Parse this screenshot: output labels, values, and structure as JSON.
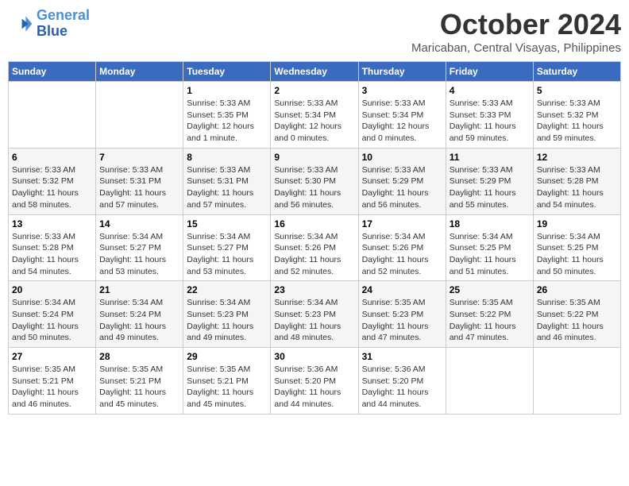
{
  "header": {
    "logo_line1": "General",
    "logo_line2": "Blue",
    "month": "October 2024",
    "location": "Maricaban, Central Visayas, Philippines"
  },
  "weekdays": [
    "Sunday",
    "Monday",
    "Tuesday",
    "Wednesday",
    "Thursday",
    "Friday",
    "Saturday"
  ],
  "weeks": [
    [
      {
        "day": "",
        "info": ""
      },
      {
        "day": "",
        "info": ""
      },
      {
        "day": "1",
        "info": "Sunrise: 5:33 AM\nSunset: 5:35 PM\nDaylight: 12 hours\nand 1 minute."
      },
      {
        "day": "2",
        "info": "Sunrise: 5:33 AM\nSunset: 5:34 PM\nDaylight: 12 hours\nand 0 minutes."
      },
      {
        "day": "3",
        "info": "Sunrise: 5:33 AM\nSunset: 5:34 PM\nDaylight: 12 hours\nand 0 minutes."
      },
      {
        "day": "4",
        "info": "Sunrise: 5:33 AM\nSunset: 5:33 PM\nDaylight: 11 hours\nand 59 minutes."
      },
      {
        "day": "5",
        "info": "Sunrise: 5:33 AM\nSunset: 5:32 PM\nDaylight: 11 hours\nand 59 minutes."
      }
    ],
    [
      {
        "day": "6",
        "info": "Sunrise: 5:33 AM\nSunset: 5:32 PM\nDaylight: 11 hours\nand 58 minutes."
      },
      {
        "day": "7",
        "info": "Sunrise: 5:33 AM\nSunset: 5:31 PM\nDaylight: 11 hours\nand 57 minutes."
      },
      {
        "day": "8",
        "info": "Sunrise: 5:33 AM\nSunset: 5:31 PM\nDaylight: 11 hours\nand 57 minutes."
      },
      {
        "day": "9",
        "info": "Sunrise: 5:33 AM\nSunset: 5:30 PM\nDaylight: 11 hours\nand 56 minutes."
      },
      {
        "day": "10",
        "info": "Sunrise: 5:33 AM\nSunset: 5:29 PM\nDaylight: 11 hours\nand 56 minutes."
      },
      {
        "day": "11",
        "info": "Sunrise: 5:33 AM\nSunset: 5:29 PM\nDaylight: 11 hours\nand 55 minutes."
      },
      {
        "day": "12",
        "info": "Sunrise: 5:33 AM\nSunset: 5:28 PM\nDaylight: 11 hours\nand 54 minutes."
      }
    ],
    [
      {
        "day": "13",
        "info": "Sunrise: 5:33 AM\nSunset: 5:28 PM\nDaylight: 11 hours\nand 54 minutes."
      },
      {
        "day": "14",
        "info": "Sunrise: 5:34 AM\nSunset: 5:27 PM\nDaylight: 11 hours\nand 53 minutes."
      },
      {
        "day": "15",
        "info": "Sunrise: 5:34 AM\nSunset: 5:27 PM\nDaylight: 11 hours\nand 53 minutes."
      },
      {
        "day": "16",
        "info": "Sunrise: 5:34 AM\nSunset: 5:26 PM\nDaylight: 11 hours\nand 52 minutes."
      },
      {
        "day": "17",
        "info": "Sunrise: 5:34 AM\nSunset: 5:26 PM\nDaylight: 11 hours\nand 52 minutes."
      },
      {
        "day": "18",
        "info": "Sunrise: 5:34 AM\nSunset: 5:25 PM\nDaylight: 11 hours\nand 51 minutes."
      },
      {
        "day": "19",
        "info": "Sunrise: 5:34 AM\nSunset: 5:25 PM\nDaylight: 11 hours\nand 50 minutes."
      }
    ],
    [
      {
        "day": "20",
        "info": "Sunrise: 5:34 AM\nSunset: 5:24 PM\nDaylight: 11 hours\nand 50 minutes."
      },
      {
        "day": "21",
        "info": "Sunrise: 5:34 AM\nSunset: 5:24 PM\nDaylight: 11 hours\nand 49 minutes."
      },
      {
        "day": "22",
        "info": "Sunrise: 5:34 AM\nSunset: 5:23 PM\nDaylight: 11 hours\nand 49 minutes."
      },
      {
        "day": "23",
        "info": "Sunrise: 5:34 AM\nSunset: 5:23 PM\nDaylight: 11 hours\nand 48 minutes."
      },
      {
        "day": "24",
        "info": "Sunrise: 5:35 AM\nSunset: 5:23 PM\nDaylight: 11 hours\nand 47 minutes."
      },
      {
        "day": "25",
        "info": "Sunrise: 5:35 AM\nSunset: 5:22 PM\nDaylight: 11 hours\nand 47 minutes."
      },
      {
        "day": "26",
        "info": "Sunrise: 5:35 AM\nSunset: 5:22 PM\nDaylight: 11 hours\nand 46 minutes."
      }
    ],
    [
      {
        "day": "27",
        "info": "Sunrise: 5:35 AM\nSunset: 5:21 PM\nDaylight: 11 hours\nand 46 minutes."
      },
      {
        "day": "28",
        "info": "Sunrise: 5:35 AM\nSunset: 5:21 PM\nDaylight: 11 hours\nand 45 minutes."
      },
      {
        "day": "29",
        "info": "Sunrise: 5:35 AM\nSunset: 5:21 PM\nDaylight: 11 hours\nand 45 minutes."
      },
      {
        "day": "30",
        "info": "Sunrise: 5:36 AM\nSunset: 5:20 PM\nDaylight: 11 hours\nand 44 minutes."
      },
      {
        "day": "31",
        "info": "Sunrise: 5:36 AM\nSunset: 5:20 PM\nDaylight: 11 hours\nand 44 minutes."
      },
      {
        "day": "",
        "info": ""
      },
      {
        "day": "",
        "info": ""
      }
    ]
  ]
}
